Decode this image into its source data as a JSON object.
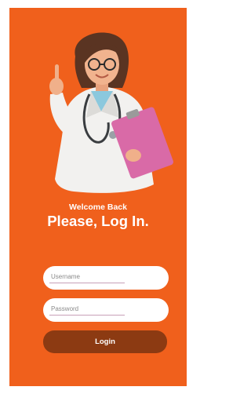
{
  "header": {
    "welcome": "Welcome Back",
    "title": "Please, Log In."
  },
  "form": {
    "username_placeholder": "Username",
    "password_placeholder": "Password",
    "login_label": "Login"
  },
  "colors": {
    "background": "#f0601c",
    "button": "#8c3a12",
    "field": "#ffffff"
  },
  "illustration": {
    "icon": "doctor-illustration"
  }
}
